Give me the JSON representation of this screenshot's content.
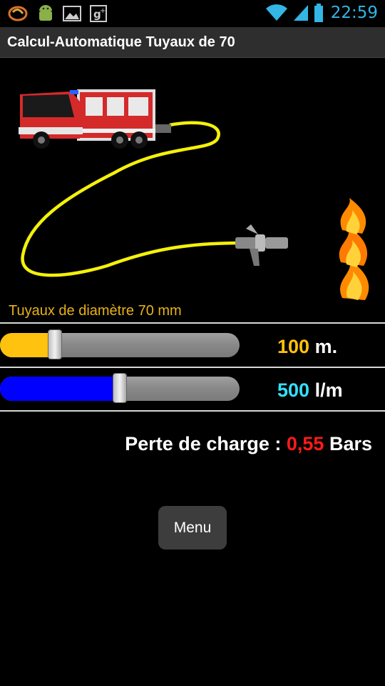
{
  "status_bar": {
    "time": "22:59",
    "left_icons": [
      "sync-icon",
      "android-icon",
      "gallery-icon",
      "google-plus-icon"
    ],
    "right_icons": [
      "wifi-icon",
      "signal-icon",
      "battery-icon"
    ],
    "accent_color": "#33b5e5"
  },
  "title_bar": {
    "title": "Calcul-Automatique Tuyaux de  70"
  },
  "illustration": {
    "items": [
      "fire-truck-image",
      "hose-image",
      "nozzle-image",
      "fire-image"
    ]
  },
  "diameter_label": "Tuyaux de diamètre 70 mm",
  "length_slider": {
    "value": "100",
    "unit": "m.",
    "fraction": 0.23,
    "color": "#ffc20e"
  },
  "flow_slider": {
    "value": "500",
    "unit": "l/m",
    "fraction": 0.5,
    "color": "#0000ff",
    "value_color": "#33e0ff"
  },
  "result": {
    "label": "Perte de charge :",
    "value": "0,55",
    "unit": "Bars",
    "value_color": "#ff1a1a"
  },
  "menu_button": {
    "label": "Menu"
  }
}
